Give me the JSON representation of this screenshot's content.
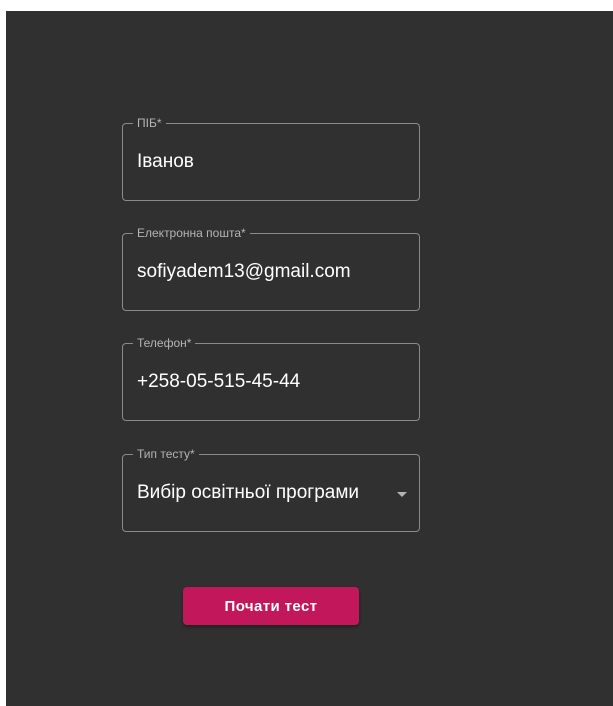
{
  "form": {
    "fields": [
      {
        "label": "ПІБ*",
        "value": "Іванов"
      },
      {
        "label": "Електронна пошта*",
        "value": "sofiyadem13@gmail.com"
      },
      {
        "label": "Телефон*",
        "value": "+258-05-515-45-44"
      }
    ],
    "test_type": {
      "label": "Тип тесту*",
      "selected": "Вибір освітньої програми",
      "icon": "chevron-down-icon"
    },
    "submit_label": "Почати тест"
  },
  "colors": {
    "background": "#303030",
    "border": "#8a8a8a",
    "label": "#b4b4b4",
    "text": "#ffffff",
    "accent": "#c2185b"
  }
}
